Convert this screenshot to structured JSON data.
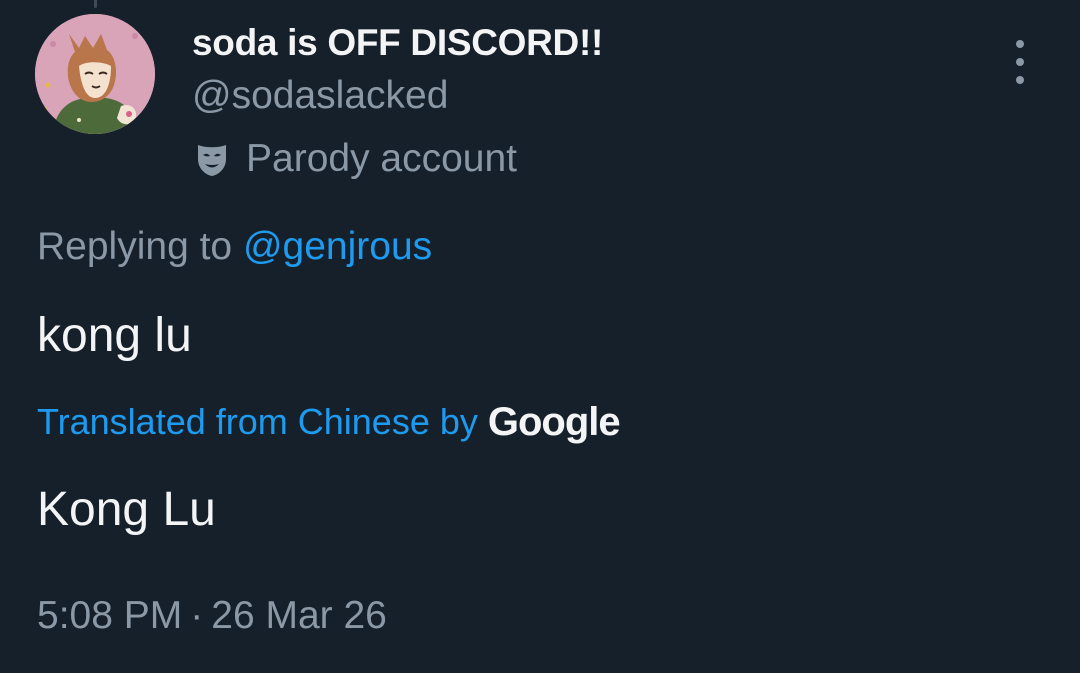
{
  "author": {
    "display_name": "soda is OFF DISCORD!!",
    "handle": "@sodaslacked",
    "avatar_icon": "avatar-image",
    "badge": {
      "icon": "theater-mask-icon",
      "label": "Parody account"
    }
  },
  "more_menu": {
    "icon": "more-vertical-icon"
  },
  "reply": {
    "prefix": "Replying to",
    "mention": "@genjrous"
  },
  "tweet": {
    "text": "kong lu"
  },
  "translation": {
    "link_label": "Translated from Chinese by",
    "provider": "Google",
    "text": "Kong Lu"
  },
  "timestamp": {
    "time": "5:08 PM",
    "separator": "·",
    "date": "26 Mar 26"
  },
  "colors": {
    "background": "#16202a",
    "primary_text": "#f2f4f5",
    "secondary_text": "#8b98a5",
    "accent": "#1d9bf0"
  }
}
